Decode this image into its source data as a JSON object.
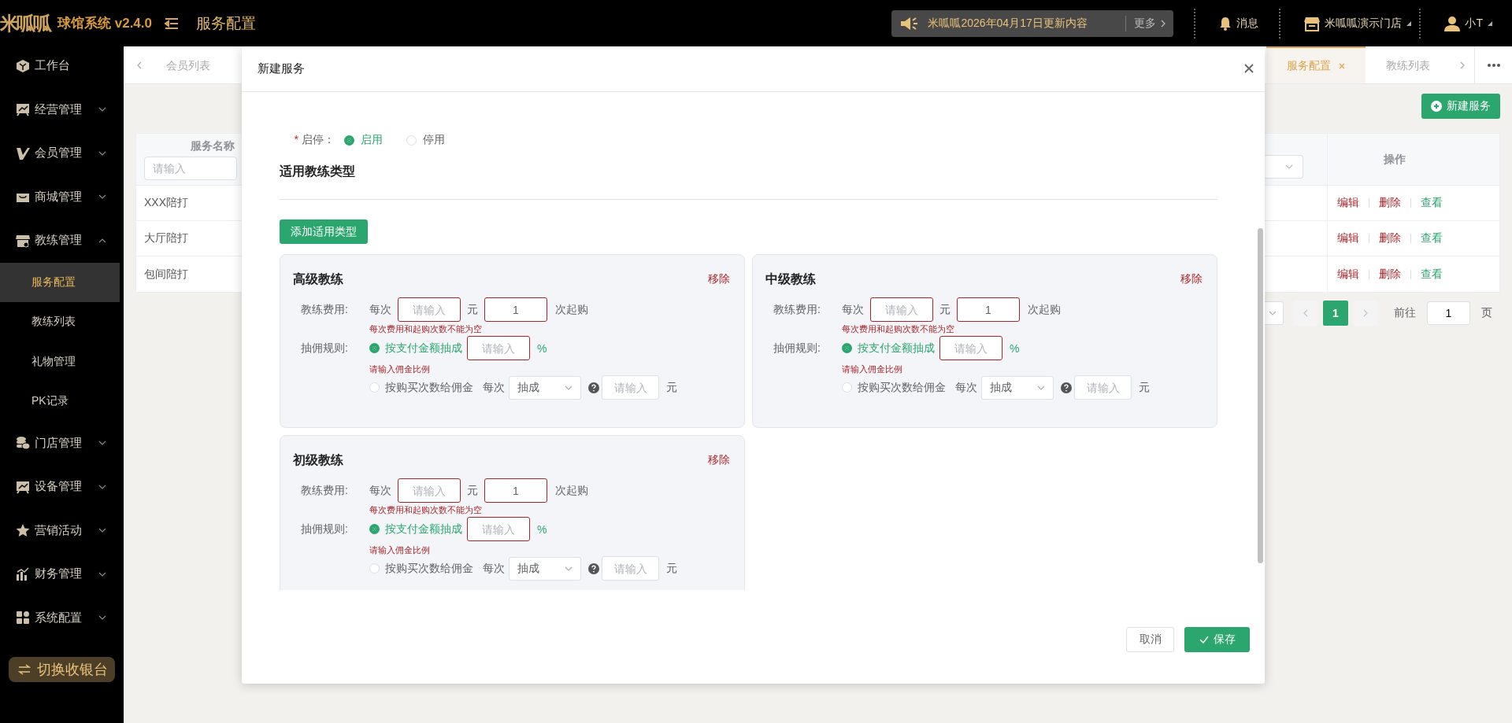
{
  "header": {
    "logo": "米呱呱",
    "app_title": "球馆系统 v2.4.0",
    "page_title": "服务配置",
    "notice": {
      "text": "米呱呱2026年04月17日更新内容",
      "more": "更多"
    },
    "messages": "消息",
    "store": "米呱呱演示门店",
    "user": "小T"
  },
  "sidebar": {
    "items": [
      {
        "kind": "link",
        "label": "工作台"
      },
      {
        "kind": "group",
        "label": "经营管理",
        "expanded": false
      },
      {
        "kind": "group",
        "label": "会员管理",
        "expanded": false
      },
      {
        "kind": "group",
        "label": "商城管理",
        "expanded": false
      },
      {
        "kind": "group",
        "label": "教练管理",
        "expanded": true,
        "children": [
          {
            "label": "服务配置",
            "selected": true
          },
          {
            "label": "教练列表",
            "selected": false
          },
          {
            "label": "礼物管理",
            "selected": false
          },
          {
            "label": "PK记录",
            "selected": false
          }
        ]
      },
      {
        "kind": "group",
        "label": "门店管理",
        "expanded": false
      },
      {
        "kind": "group",
        "label": "设备管理",
        "expanded": false
      },
      {
        "kind": "group",
        "label": "营销活动",
        "expanded": false
      },
      {
        "kind": "group",
        "label": "财务管理",
        "expanded": false
      },
      {
        "kind": "group",
        "label": "系统配置",
        "expanded": false
      }
    ],
    "switch_button": "切换收银台"
  },
  "tabs": [
    {
      "label": "会员列表",
      "selected": false
    },
    {
      "label": "服务配置",
      "selected": true
    },
    {
      "label": "教练列表",
      "selected": false
    }
  ],
  "new_button": "新建服务",
  "table": {
    "columns": [
      {
        "title": "服务名称",
        "filter_placeholder": "请输入"
      },
      {
        "title": "操作"
      }
    ],
    "rows": [
      {
        "name": "XXX陪打",
        "actions": [
          "编辑",
          "删除",
          "查看"
        ]
      },
      {
        "name": "大厅陪打",
        "actions": [
          "编辑",
          "删除",
          "查看"
        ]
      },
      {
        "name": "包间陪打",
        "actions": [
          "编辑",
          "删除",
          "查看"
        ]
      }
    ]
  },
  "pagination": {
    "pages": [
      {
        "label": "1",
        "selected": true
      }
    ],
    "goto_label": "前往",
    "goto_value": "1",
    "page_suffix": "页"
  },
  "modal": {
    "title": "新建服务",
    "status": {
      "label": "启停：",
      "required_mark": "*",
      "options": [
        {
          "label": "启用",
          "selected": true
        },
        {
          "label": "停用",
          "selected": false
        }
      ]
    },
    "section_title": "适用教练类型",
    "add_button": "添加适用类型",
    "cards": [
      {
        "title": "高级教练",
        "remove": "移除",
        "fee_label": "教练费用:",
        "per": "每次",
        "price": {
          "placeholder": "请输入",
          "invalid": true
        },
        "unit": "元",
        "min_count": {
          "value": "1",
          "invalid": true
        },
        "min_suffix": "次起购",
        "fee_error": "每次费用和起购次数不能为空",
        "commission_label": "抽佣规则:",
        "options": [
          {
            "label": "按支付金额抽成",
            "selected": true
          },
          {
            "label": "按购买次数给佣金",
            "selected": false
          }
        ],
        "percent": {
          "placeholder": "请输入",
          "invalid": true
        },
        "percent_sign": "%",
        "commission_error": "请输入佣金比例",
        "per_count": "每次",
        "mode": "抽成",
        "amount": {
          "placeholder": "请输入",
          "invalid": false
        },
        "amount_unit": "元"
      },
      {
        "title": "中级教练",
        "remove": "移除",
        "fee_label": "教练费用:",
        "per": "每次",
        "price": {
          "placeholder": "请输入",
          "invalid": true
        },
        "unit": "元",
        "min_count": {
          "value": "1",
          "invalid": true
        },
        "min_suffix": "次起购",
        "fee_error": "每次费用和起购次数不能为空",
        "commission_label": "抽佣规则:",
        "options": [
          {
            "label": "按支付金额抽成",
            "selected": true
          },
          {
            "label": "按购买次数给佣金",
            "selected": false
          }
        ],
        "percent": {
          "placeholder": "请输入",
          "invalid": true
        },
        "percent_sign": "%",
        "commission_error": "请输入佣金比例",
        "per_count": "每次",
        "mode": "抽成",
        "amount": {
          "placeholder": "请输入",
          "invalid": false
        },
        "amount_unit": "元"
      },
      {
        "title": "初级教练",
        "remove": "移除",
        "fee_label": "教练费用:",
        "per": "每次",
        "price": {
          "placeholder": "请输入",
          "invalid": true
        },
        "unit": "元",
        "min_count": {
          "value": "1",
          "invalid": true
        },
        "min_suffix": "次起购",
        "fee_error": "每次费用和起购次数不能为空",
        "commission_label": "抽佣规则:",
        "options": [
          {
            "label": "按支付金额抽成",
            "selected": true
          },
          {
            "label": "按购买次数给佣金",
            "selected": false
          }
        ],
        "percent": {
          "placeholder": "请输入",
          "invalid": true
        },
        "percent_sign": "%",
        "commission_error": "请输入佣金比例",
        "per_count": "每次",
        "mode": "抽成",
        "amount": {
          "placeholder": "请输入",
          "invalid": false
        },
        "amount_unit": "元"
      }
    ],
    "cancel_button": "取消",
    "save_button": "保存"
  }
}
